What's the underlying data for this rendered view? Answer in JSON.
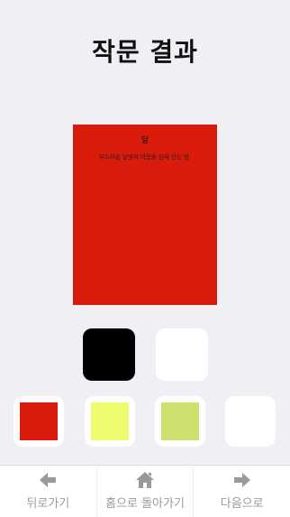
{
  "page": {
    "title": "작문 결과"
  },
  "card": {
    "title": "달",
    "body": "부드러운 달빛이 마음을 감싸 안는 밤.",
    "background_color": "#d81b0a",
    "text_color": "#111111"
  },
  "text_color_options": [
    {
      "name": "black",
      "color": "#000000",
      "selected": true
    },
    {
      "name": "white",
      "color": "#ffffff",
      "selected": false
    }
  ],
  "background_color_options": [
    {
      "name": "red",
      "color": "#d81b0a",
      "selected": true
    },
    {
      "name": "yellow",
      "color": "#eefb6c",
      "selected": false
    },
    {
      "name": "green",
      "color": "#cfe06f",
      "selected": false
    },
    {
      "name": "white",
      "color": "#ffffff",
      "selected": false
    }
  ],
  "bottom_nav": {
    "back_label": "뒤로가기",
    "back_icon": "arrow-left-icon",
    "home_label": "홈으로 돌아가기",
    "home_icon": "home-icon",
    "next_label": "다음으로",
    "next_icon": "arrow-right-icon",
    "icon_color": "#9a9a9a"
  }
}
